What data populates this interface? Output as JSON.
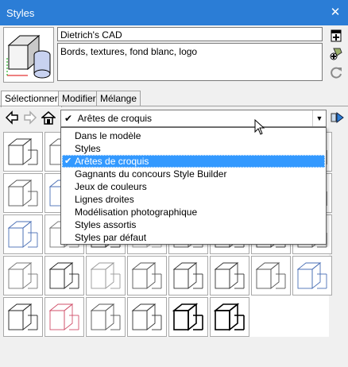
{
  "window": {
    "title": "Styles",
    "close_glyph": "✕"
  },
  "style_info": {
    "name": "Dietrich's CAD",
    "description": "Bords, textures, fond blanc, logo"
  },
  "side_icons": [
    "create-style-icon",
    "update-style-icon",
    "refresh-icon"
  ],
  "tabs": [
    {
      "label": "Sélectionner",
      "active": true
    },
    {
      "label": "Modifier",
      "active": false
    },
    {
      "label": "Mélange",
      "active": false
    }
  ],
  "nav_icons": [
    "back-arrow-icon",
    "forward-arrow-icon",
    "home-icon",
    "details-arrow-icon"
  ],
  "collection": {
    "selected": "Arêtes de croquis",
    "check_glyph": "✔",
    "arrow_glyph": "▼"
  },
  "dropdown": {
    "options": [
      "Dans le modèle",
      "Styles",
      "Arêtes de croquis",
      "Gagnants du concours Style Builder",
      "Jeux de couleurs",
      "Lignes droites",
      "Modélisation photographique",
      "Styles assortis",
      "Styles par défaut"
    ],
    "selected_index": 2
  },
  "colors": {
    "titlebar": "#2b7dd6",
    "selection": "#3399ff"
  }
}
